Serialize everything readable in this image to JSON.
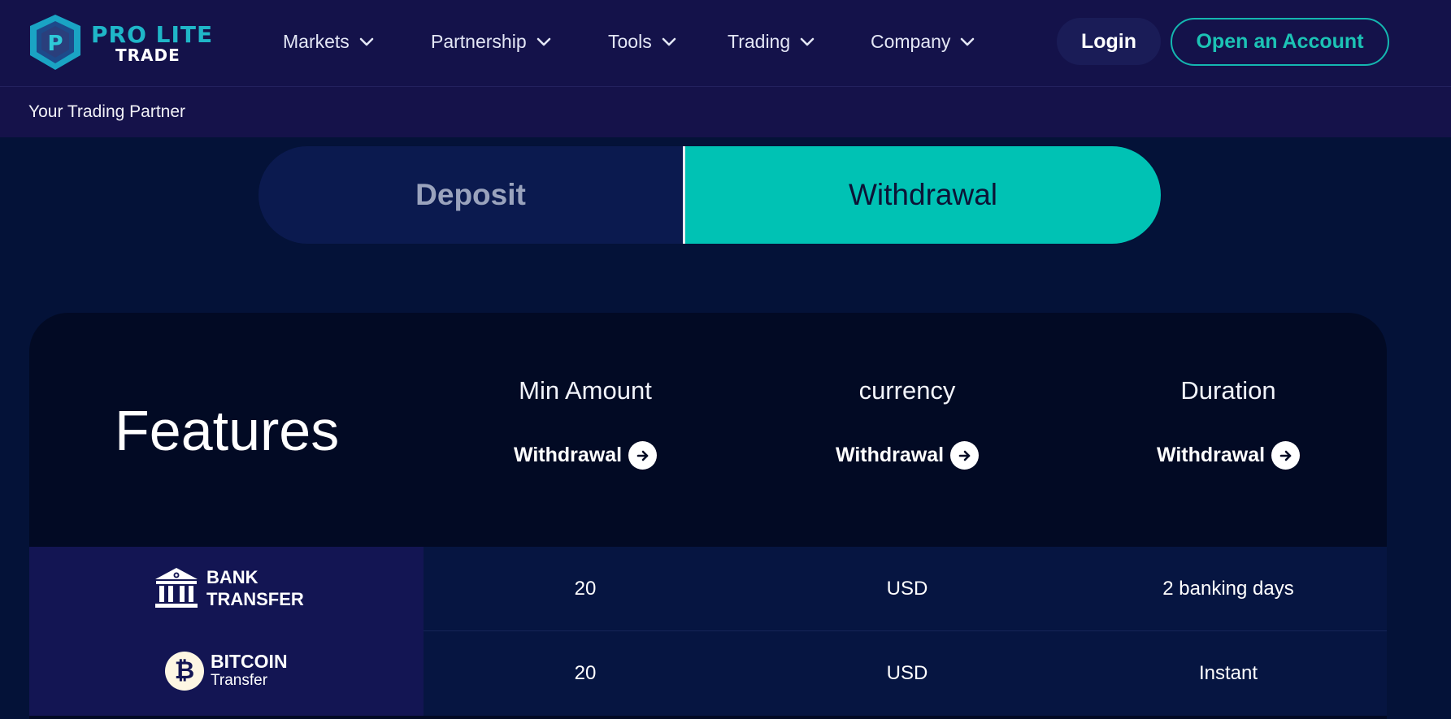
{
  "brand": {
    "line1": "PRO LITE",
    "line2": "TRADE",
    "mark_letter": "P"
  },
  "nav": {
    "items": [
      {
        "label": "Markets"
      },
      {
        "label": "Partnership"
      },
      {
        "label": "Tools"
      },
      {
        "label": "Trading"
      },
      {
        "label": "Company"
      }
    ],
    "login": "Login",
    "open_account": "Open an Account"
  },
  "tagline": "Your Trading Partner",
  "tabs": {
    "deposit": "Deposit",
    "withdrawal": "Withdrawal",
    "active": "Withdrawal"
  },
  "table": {
    "title": "Features",
    "columns": [
      {
        "title": "Min Amount",
        "link": "Withdrawal"
      },
      {
        "title": "currency",
        "link": "Withdrawal"
      },
      {
        "title": "Duration",
        "link": "Withdrawal"
      }
    ],
    "rows": [
      {
        "method_line1": "BANK",
        "method_line2": "TRANSFER",
        "min_amount": "20",
        "currency": "USD",
        "duration": "2 banking days"
      },
      {
        "method_line1": "BITCOIN",
        "method_line2": "Transfer",
        "btc_symbol": "₿",
        "min_amount": "20",
        "currency": "USD",
        "duration": "Instant"
      }
    ]
  },
  "colors": {
    "background": "#041238",
    "header": "#14124a",
    "accent": "#00c2b4",
    "card": "#020a24",
    "row": "#061541",
    "method_cell": "#131553"
  }
}
